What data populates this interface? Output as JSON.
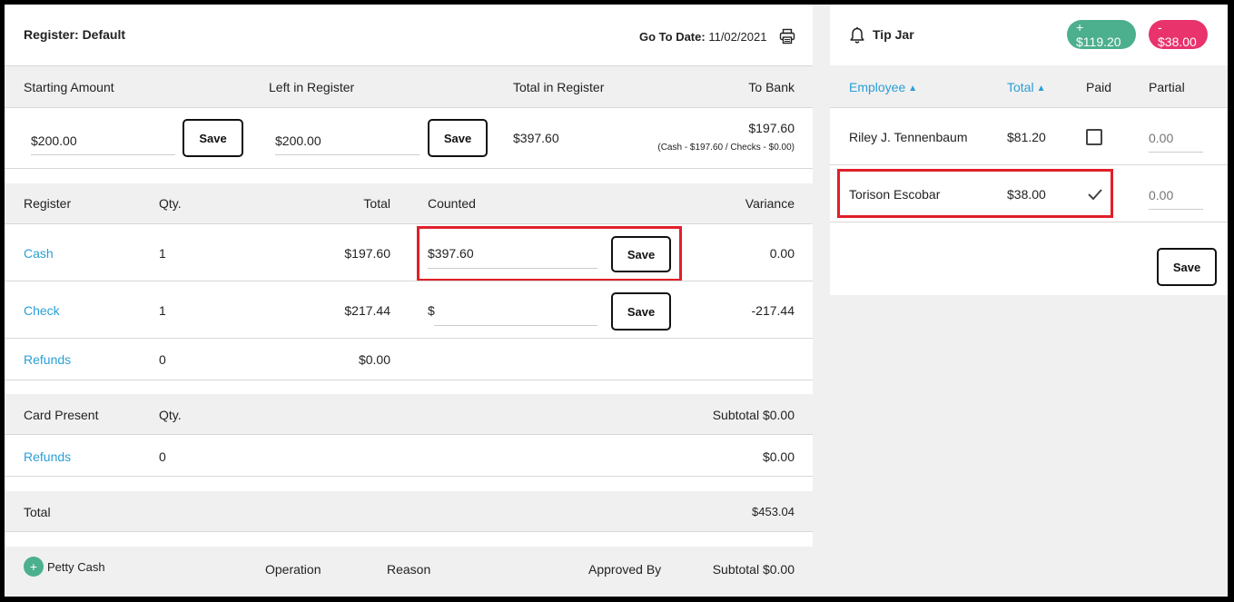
{
  "register": {
    "title": "Register: Default",
    "goto_label": "Go To Date:",
    "goto_value": "11/02/2021",
    "summary_headers": [
      "Starting Amount",
      "Left in Register",
      "Total in Register",
      "To Bank"
    ],
    "starting_amount": "$200.00",
    "left_in_register": "$200.00",
    "total_in_register": "$397.60",
    "to_bank": "$197.60",
    "to_bank_detail": "(Cash - $197.60 / Checks - $0.00)",
    "save_label": "Save"
  },
  "register_table": {
    "headers": {
      "register": "Register",
      "qty": "Qty.",
      "total": "Total",
      "counted": "Counted",
      "variance": "Variance"
    },
    "rows": [
      {
        "name": "Cash",
        "qty": "1",
        "total": "$197.60",
        "counted": "$397.60",
        "variance": "0.00"
      },
      {
        "name": "Check",
        "qty": "1",
        "total": "$217.44",
        "counted_prefix": "$",
        "variance": "-217.44"
      },
      {
        "name": "Refunds",
        "qty": "0",
        "total": "$0.00"
      }
    ]
  },
  "card_present": {
    "headers": {
      "name": "Card Present",
      "qty": "Qty.",
      "subtotal": "Subtotal $0.00"
    },
    "rows": [
      {
        "name": "Refunds",
        "qty": "0",
        "total": "$0.00"
      }
    ]
  },
  "totals": {
    "label": "Total",
    "value": "$453.04"
  },
  "petty_cash": {
    "add_glyph": "+",
    "label": "Petty Cash",
    "operation": "Operation",
    "reason": "Reason",
    "approved_by": "Approved By",
    "subtotal": "Subtotal $0.00"
  },
  "tip_jar": {
    "title": "Tip Jar",
    "plus_badge": "+ $119.20",
    "minus_badge": "- $38.00",
    "headers": {
      "employee": "Employee",
      "total": "Total",
      "paid": "Paid",
      "partial": "Partial"
    },
    "rows": [
      {
        "employee": "Riley J. Tennenbaum",
        "total": "$81.20",
        "paid": false,
        "partial_placeholder": "0.00"
      },
      {
        "employee": "Torison Escobar",
        "total": "$38.00",
        "paid": true,
        "partial_placeholder": "0.00"
      }
    ],
    "save_label": "Save"
  },
  "colors": {
    "link": "#2a9fd6",
    "plus_badge": "#4caf8e",
    "minus_badge": "#e8336d",
    "highlight": "#e0202a"
  },
  "icons": [
    "printer-icon",
    "bell-icon",
    "sort-icon",
    "checkbox-icon",
    "check-icon",
    "plus-icon"
  ]
}
